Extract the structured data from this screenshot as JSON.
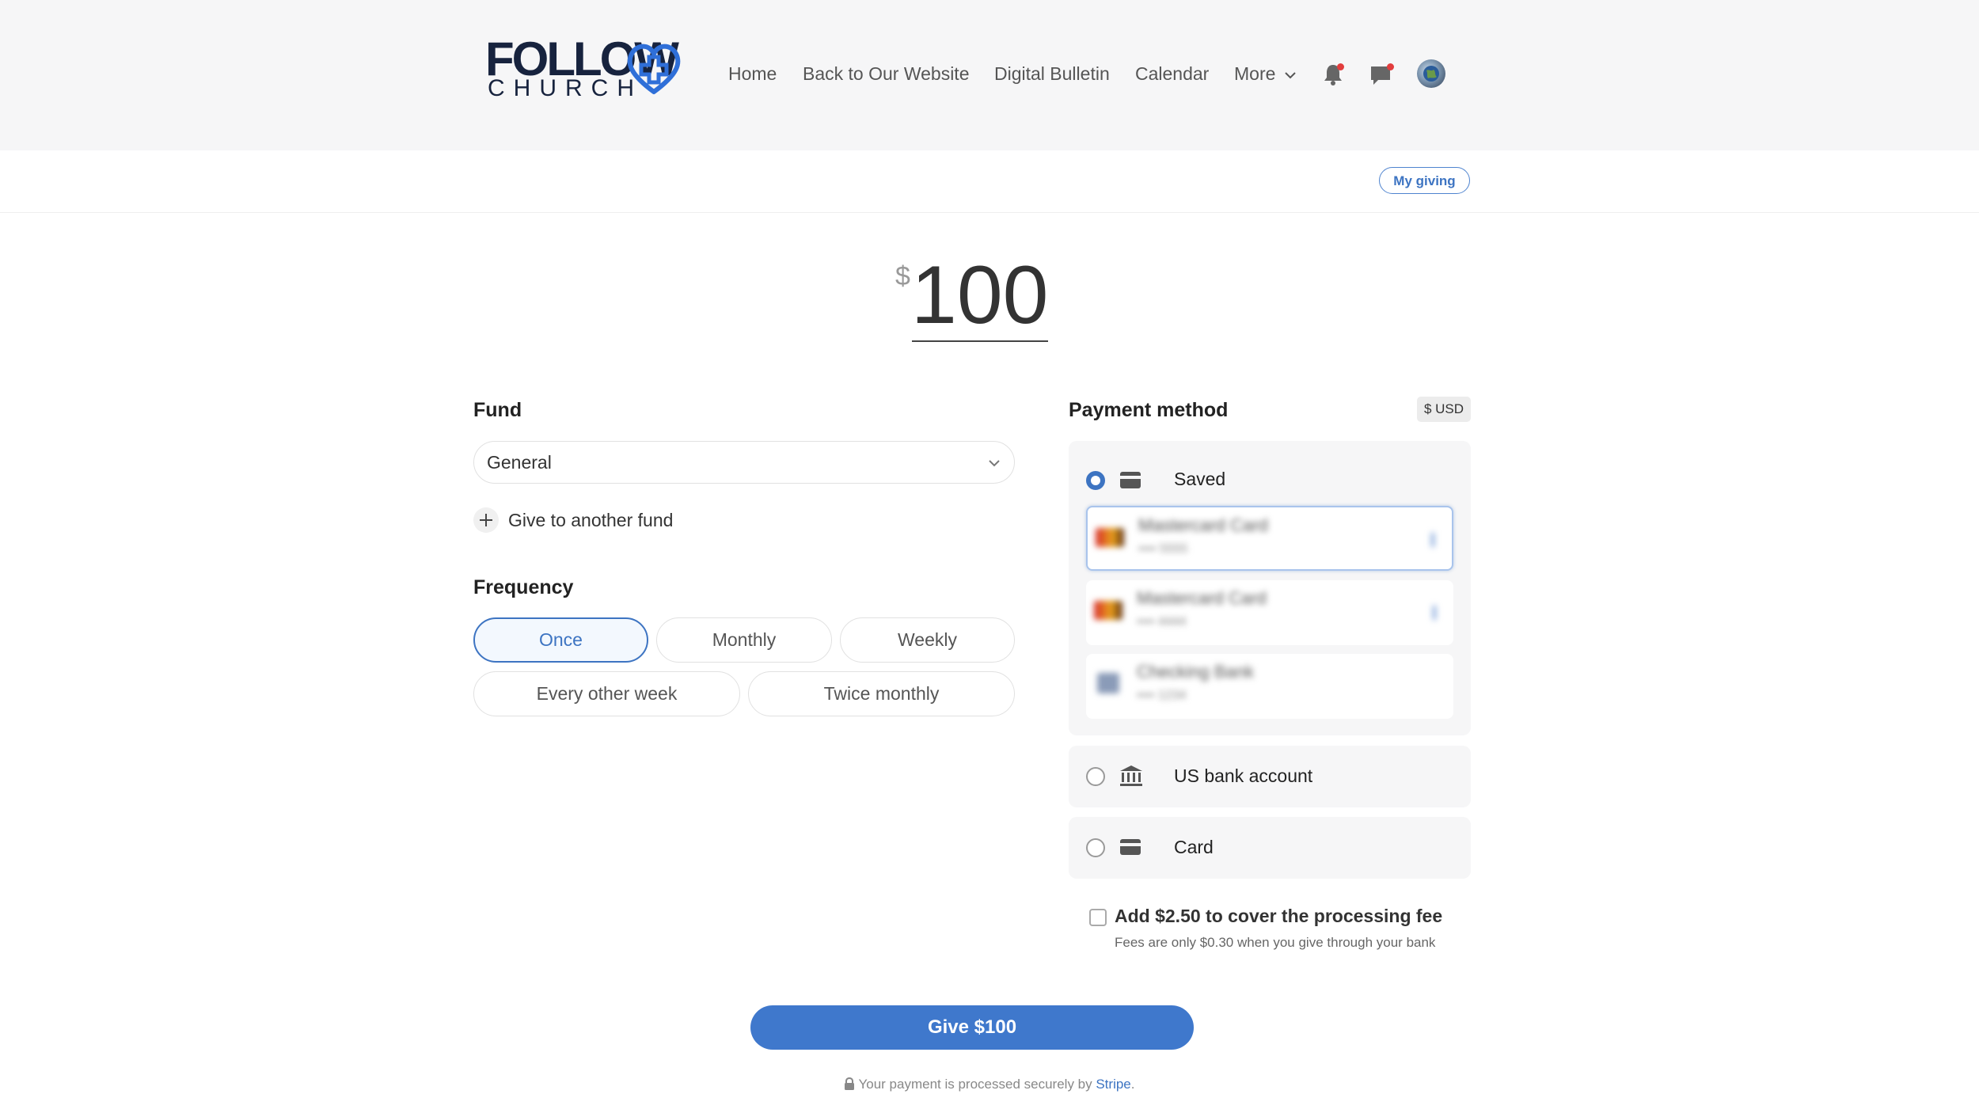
{
  "header": {
    "logo_top": "FOLLOW",
    "logo_bottom": "CHURCH",
    "nav": [
      "Home",
      "Back to Our Website",
      "Digital Bulletin",
      "Calendar",
      "More"
    ],
    "icons": [
      "bell-icon",
      "chat-icon",
      "avatar"
    ]
  },
  "my_giving": "My giving",
  "amount": {
    "currency_symbol": "$",
    "value": "100"
  },
  "fund": {
    "heading": "Fund",
    "selected": "General",
    "add_label": "Give to another fund"
  },
  "frequency": {
    "heading": "Frequency",
    "options": [
      "Once",
      "Monthly",
      "Weekly",
      "Every other week",
      "Twice monthly"
    ],
    "selected": "Once"
  },
  "payment": {
    "heading": "Payment method",
    "currency_badge": "$ USD",
    "saved_label": "Saved",
    "saved_methods": [
      {
        "name": "Mastercard Card",
        "last4": "•••• 5555"
      },
      {
        "name": "Mastercard Card",
        "last4": "•••• 4444"
      },
      {
        "name": "Checking Bank",
        "last4": "•••• 1234"
      }
    ],
    "bank_label": "US bank account",
    "card_label": "Card"
  },
  "fee": {
    "label": "Add $2.50 to cover the processing fee",
    "note": "Fees are only $0.30 when you give through your bank"
  },
  "submit_label": "Give $100",
  "secure": {
    "text": "Your payment is processed securely by ",
    "link": "Stripe",
    "end": "."
  },
  "colors": {
    "accent": "#3f78cc",
    "logo_dark": "#17233e",
    "logo_blue": "#2f6fd8",
    "notify_dot": "#e23d3d"
  }
}
